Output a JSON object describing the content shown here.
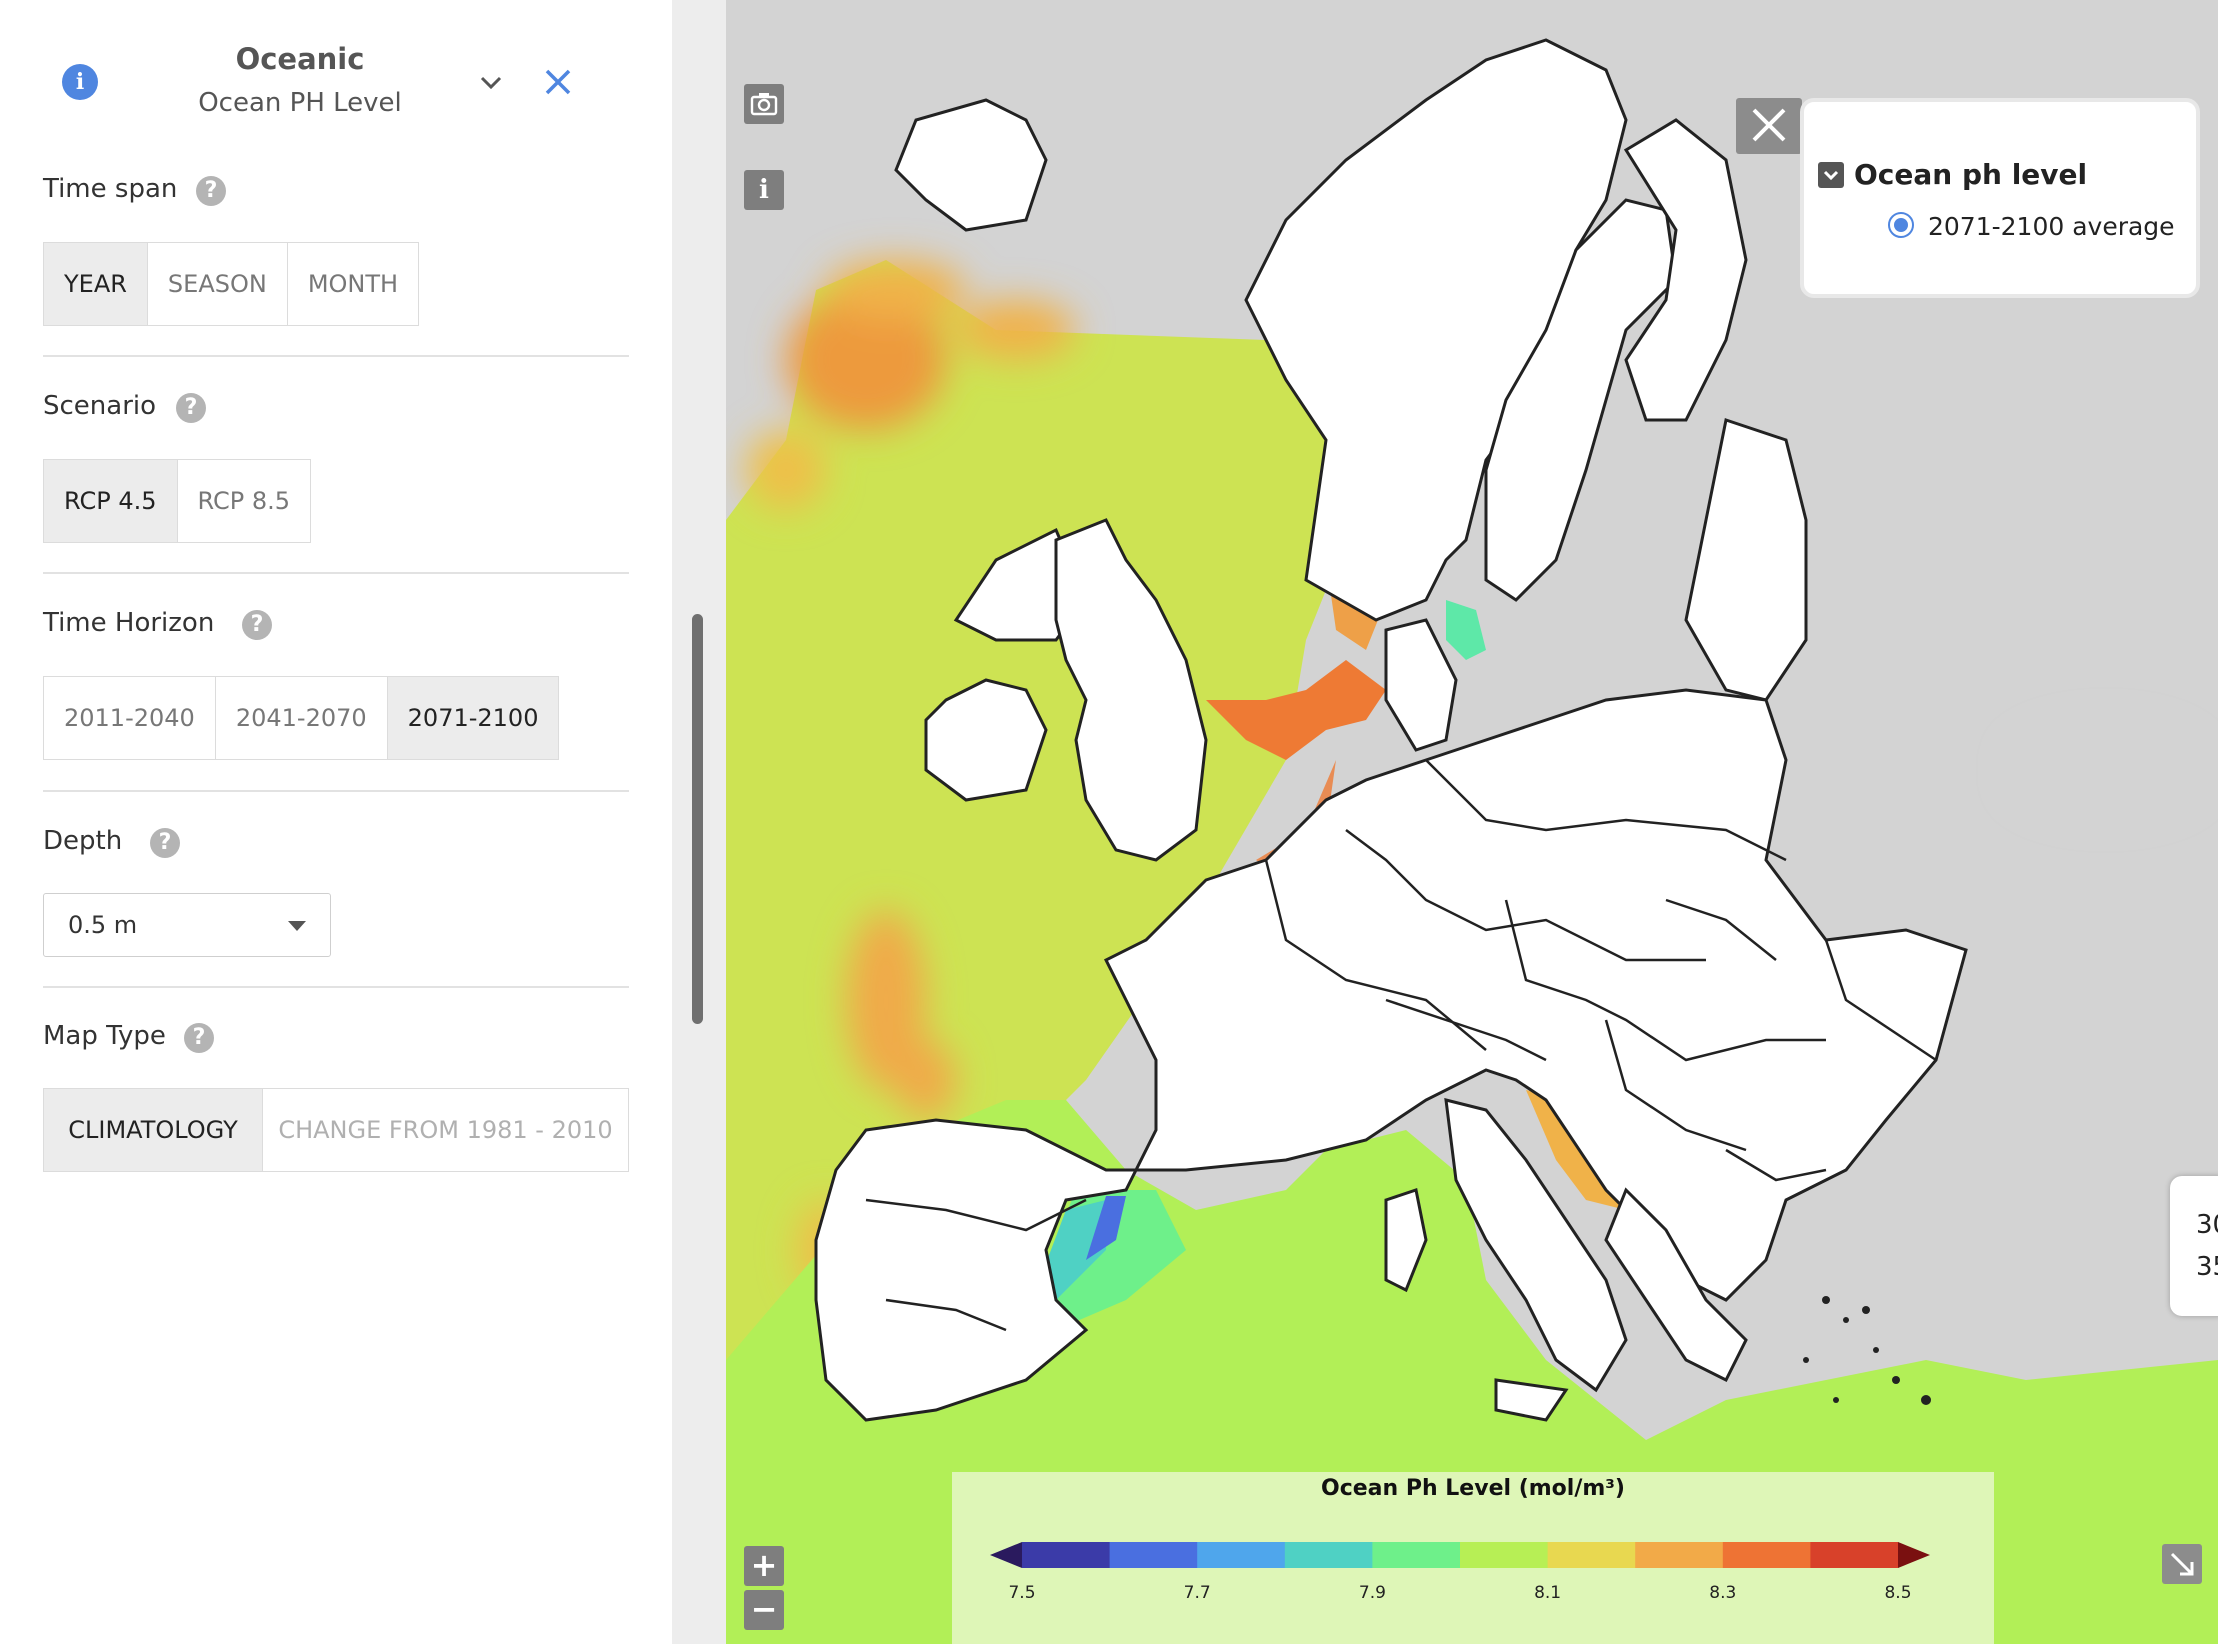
{
  "panel": {
    "title": "Oceanic",
    "subtitle": "Ocean PH Level",
    "info_icon": "i",
    "sections": {
      "time_span": {
        "label": "Time span",
        "options": [
          "YEAR",
          "SEASON",
          "MONTH"
        ],
        "selected": "YEAR"
      },
      "scenario": {
        "label": "Scenario",
        "options": [
          "RCP 4.5",
          "RCP 8.5"
        ],
        "selected": "RCP 4.5"
      },
      "time_horizon": {
        "label": "Time Horizon",
        "options": [
          "2011-2040",
          "2041-2070",
          "2071-2100"
        ],
        "selected": "2071-2100"
      },
      "depth": {
        "label": "Depth",
        "value": "0.5 m"
      },
      "map_type": {
        "label": "Map Type",
        "options": [
          "CLIMATOLOGY",
          "CHANGE FROM 1981 - 2010"
        ],
        "selected": "CLIMATOLOGY"
      }
    },
    "help_glyph": "?"
  },
  "map": {
    "info_icon": "i",
    "zoom_in": "+",
    "zoom_out": "−",
    "legend": {
      "title": "Ocean ph level",
      "item": "2071-2100 average"
    },
    "popup_lines": [
      "30",
      "35"
    ],
    "colorbar": {
      "title": "Ocean Ph Level (mol/m³)",
      "ticks": [
        "7.5",
        "7.7",
        "7.9",
        "8.1",
        "8.3",
        "8.5"
      ],
      "colors": [
        "#3b3ba8",
        "#4a6fe0",
        "#4fa6ec",
        "#4fd1c4",
        "#6ef08a",
        "#b7ef55",
        "#e8d850",
        "#f2aa48",
        "#ee7334",
        "#d8412a"
      ],
      "under_color": "#2a1a5e",
      "over_color": "#7a1010"
    }
  }
}
